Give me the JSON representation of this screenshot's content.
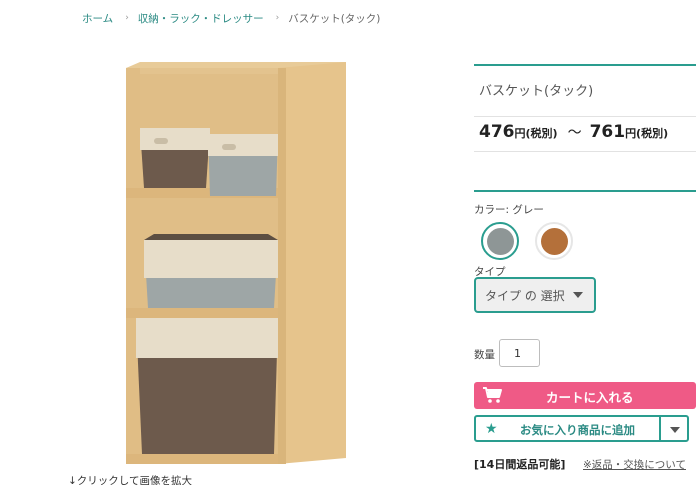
{
  "breadcrumb": {
    "items": [
      "ホーム",
      "収納・ラック・ドレッサー"
    ],
    "separator": "›",
    "current": "バスケット(タック)"
  },
  "image": {
    "caption": "↓クリックして画像を拡大"
  },
  "product": {
    "name": "バスケット(タック)",
    "price_min": "476",
    "price_max": "761",
    "price_suffix": "円(税別)",
    "price_separator": "～"
  },
  "options": {
    "color_label": "カラー: グレー",
    "colors": [
      {
        "name": "grey",
        "hex": "#8e9696",
        "selected": true
      },
      {
        "name": "brown",
        "hex": "#b4703a",
        "selected": false
      }
    ],
    "type_label": "タイプ",
    "type_select": "タイプ の 選択",
    "quantity_label": "数量",
    "quantity_value": "1"
  },
  "actions": {
    "cart_button": "カートに入れる",
    "favorite_button": "お気に入り商品に追加"
  },
  "footer": {
    "return_policy": "[14日間返品可能]",
    "return_link": "※返品・交換について"
  },
  "colors": {
    "accent": "#2a9d8f",
    "cart": "#ef5a86",
    "link": "#2a8a83"
  }
}
